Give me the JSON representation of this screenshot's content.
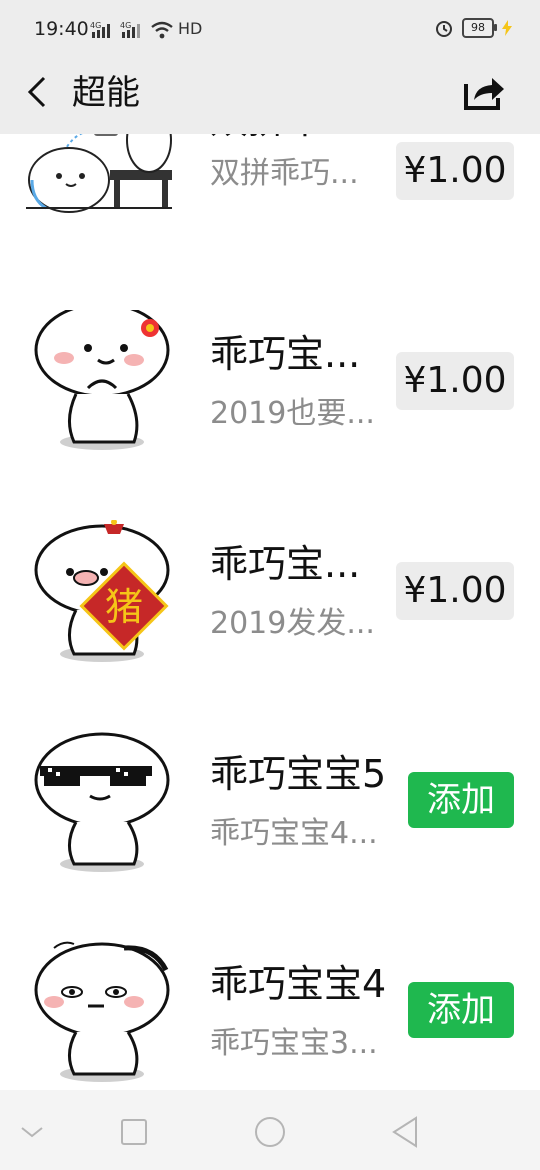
{
  "status_bar": {
    "time": "19:40",
    "signal_labels": [
      "4G",
      "4G"
    ],
    "hd_label": "HD",
    "battery": "98"
  },
  "header": {
    "title": "超能"
  },
  "items": [
    {
      "title": "双拼乖...",
      "subtitle": "双拼乖巧...",
      "action": "¥1.00",
      "action_type": "price"
    },
    {
      "title": "乖巧宝...",
      "subtitle": "2019也要...",
      "action": "¥1.00",
      "action_type": "price"
    },
    {
      "title": "乖巧宝...",
      "subtitle": "2019发发...",
      "action": "¥1.00",
      "action_type": "price"
    },
    {
      "title": "乖巧宝宝5",
      "subtitle": "乖巧宝宝4...",
      "action": "添加",
      "action_type": "add"
    },
    {
      "title": "乖巧宝宝4",
      "subtitle": "乖巧宝宝3...",
      "action": "添加",
      "action_type": "add"
    }
  ],
  "sticker_texts": {
    "fu_char": "猪"
  },
  "colors": {
    "accent_green": "#1fb84f",
    "header_bg": "#ededed",
    "price_bg": "#ececec"
  }
}
